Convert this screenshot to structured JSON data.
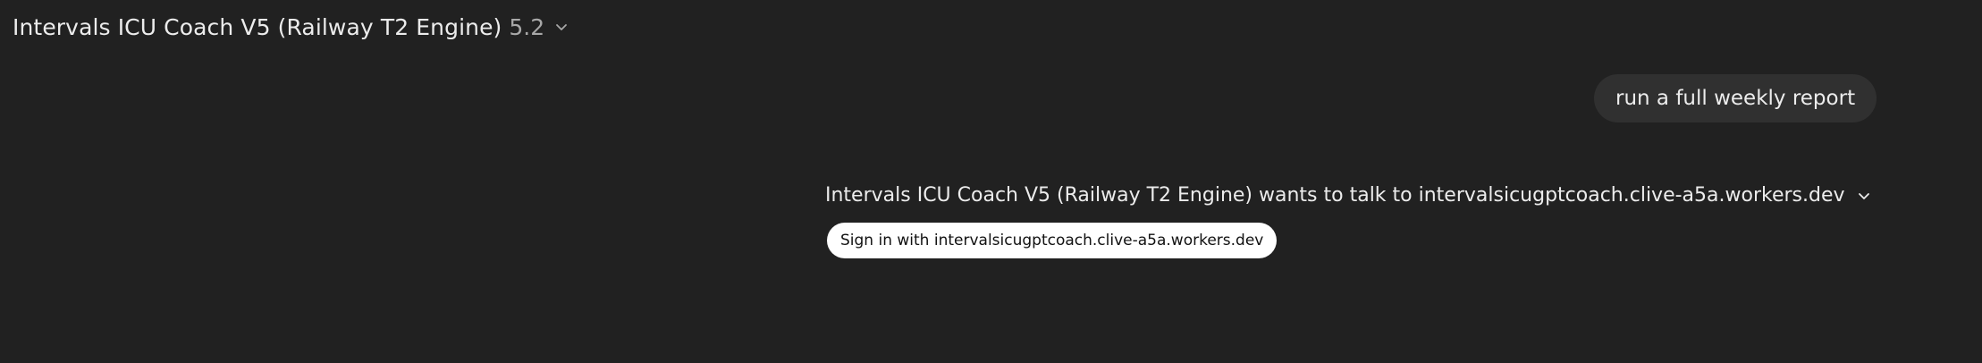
{
  "header": {
    "model_name": "Intervals ICU Coach V5 (Railway T2 Engine)",
    "model_version": "5.2",
    "dropdown_icon": "chevron-down-icon"
  },
  "conversation": {
    "user_message": "run a full weekly report",
    "tool_call": {
      "text": "Intervals ICU Coach V5 (Railway T2 Engine) wants to talk to intervalsicugptcoach.clive-a5a.workers.dev",
      "expand_icon": "chevron-down-icon"
    },
    "signin_button_label": "Sign in with intervalsicugptcoach.clive-a5a.workers.dev"
  },
  "colors": {
    "background": "#212121",
    "bubble": "#303030",
    "text": "#ececec",
    "muted": "#a8a8a8",
    "button_bg": "#ffffff",
    "button_text": "#111111"
  }
}
